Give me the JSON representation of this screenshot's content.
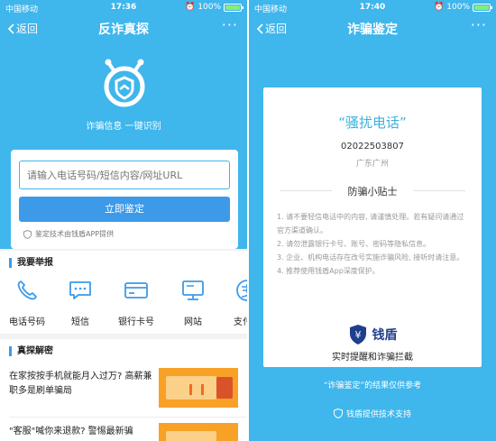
{
  "left": {
    "status": {
      "carrier": "中国移动",
      "time": "17:36",
      "battery": "100%",
      "battery_level": 1.0
    },
    "nav": {
      "back": "返回",
      "title": "反诈真探",
      "more": "···"
    },
    "hero": {
      "tagline": "诈骗信息 一键识别"
    },
    "search": {
      "placeholder": "请输入电话号码/短信内容/网址URL",
      "button": "立即鉴定",
      "powered": "鉴定技术由钱盾APP提供"
    },
    "report": {
      "title": "我要举报",
      "items": [
        {
          "label": "电话号码",
          "icon": "phone-icon"
        },
        {
          "label": "短信",
          "icon": "sms-icon"
        },
        {
          "label": "银行卡号",
          "icon": "bank-card-icon"
        },
        {
          "label": "网站",
          "icon": "website-icon"
        },
        {
          "label": "支付宝",
          "icon": "alipay-icon"
        }
      ]
    },
    "reveal": {
      "title": "真探解密",
      "articles": [
        {
          "title": "在家按按手机就能月入过万? 高薪兼职多是刷单骗局"
        },
        {
          "title": "\"客服\"喊你来退款? 警惕最新骗"
        }
      ]
    }
  },
  "right": {
    "status": {
      "carrier": "中国移动",
      "time": "17:40",
      "battery": "100%",
      "battery_level": 1.0
    },
    "nav": {
      "back": "返回",
      "title": "诈骗鉴定",
      "more": "···"
    },
    "result": {
      "label": "“骚扰电话”",
      "phone": "02022503807",
      "location": "广东广州",
      "tips_title": "防骗小贴士",
      "tips": [
        "1. 请不要轻信电话中的内容, 请谨慎处理。若有疑问请通过官方渠道确认。",
        "2. 请勿泄露银行卡号、账号、密码等隐私信息。",
        "3. 企业、机构电话存在改号实施诈骗风险, 接听时请注意。",
        "4. 推荐使用钱盾App深度保护。"
      ],
      "brand": "钱盾",
      "brand_glyph": "¥",
      "slogan": "实时提醒和诈骗拦截"
    },
    "disclaimer": "“诈骗鉴定”的结果仅供参考",
    "credit": "钱盾提供技术支持"
  },
  "colors": {
    "bg": "#3fb6ec",
    "button": "#3d9ae8",
    "accent": "#3db1dd",
    "brand": "#1f3f8c"
  }
}
